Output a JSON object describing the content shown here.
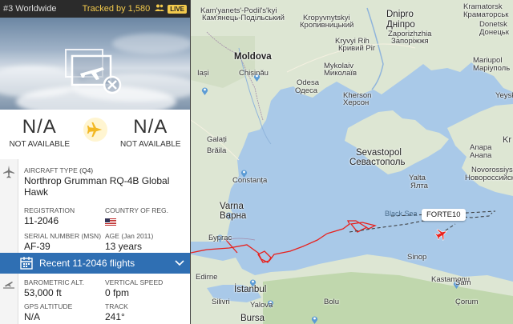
{
  "header": {
    "rank": "#3 Worldwide",
    "tracked_label": "Tracked by 1,580",
    "live_badge": "LIVE"
  },
  "photo": {
    "icon": "no-photo-airplane-icon"
  },
  "route": {
    "origin_code": "N/A",
    "origin_sub": "NOT AVAILABLE",
    "destination_code": "N/A",
    "destination_sub": "NOT AVAILABLE",
    "icon": "airplane-icon"
  },
  "aircraft": {
    "type_label": "AIRCRAFT TYPE",
    "type_code": "(Q4)",
    "type_value": "Northrop Grumman RQ-4B Global Hawk",
    "registration_label": "REGISTRATION",
    "registration_value": "11-2046",
    "country_label": "COUNTRY OF REG.",
    "country_flag": "us-flag",
    "serial_label": "SERIAL NUMBER (MSN)",
    "serial_value": "AF-39",
    "age_label": "AGE",
    "age_sub": "(Jan 2011)",
    "age_value": "13 years"
  },
  "recent_flights": {
    "label": "Recent 11-2046 flights"
  },
  "flight": {
    "baro_label": "BAROMETRIC ALT.",
    "baro_value": "53,000 ft",
    "vspeed_label": "VERTICAL SPEED",
    "vspeed_value": "0 fpm",
    "gps_label": "GPS ALTITUDE",
    "gps_value": "N/A",
    "track_label": "TRACK",
    "track_value": "241°"
  },
  "map": {
    "callsign": "FORTE10",
    "labels": [
      "Kam'yanets'-Podil's'kyi",
      "Кам'янець-Подільський",
      "Kropyvnytskyi",
      "Кропивницький",
      "Dnipro",
      "Дніпро",
      "Kramatorsk",
      "Краматорськ",
      "Zaporizhzhia",
      "Запоріжжя",
      "Kryvyi Rih",
      "Кривий Ріг",
      "Donetsk",
      "Донецьк",
      "Moldova",
      "Chișinău",
      "Mykolaiv",
      "Миколаїв",
      "Mariupol",
      "Маріуполь",
      "Iași",
      "Odesa",
      "Одеса",
      "Kherson",
      "Херсон",
      "Yeysk",
      "Sevastopol",
      "Севастополь",
      "Galați",
      "Brăila",
      "Anapa",
      "Анапа",
      "Kr",
      "Yalta",
      "Ялта",
      "Novorossiysk",
      "Новороссийск",
      "Constanța",
      "Varna",
      "Варна",
      "Black Sea",
      "Бургас",
      "Sinop",
      "Edirne",
      "Kastamonu",
      "Sam",
      "İstanbul",
      "Silivri",
      "Yalova",
      "Bolu",
      "Çorum",
      "Bursa"
    ]
  }
}
